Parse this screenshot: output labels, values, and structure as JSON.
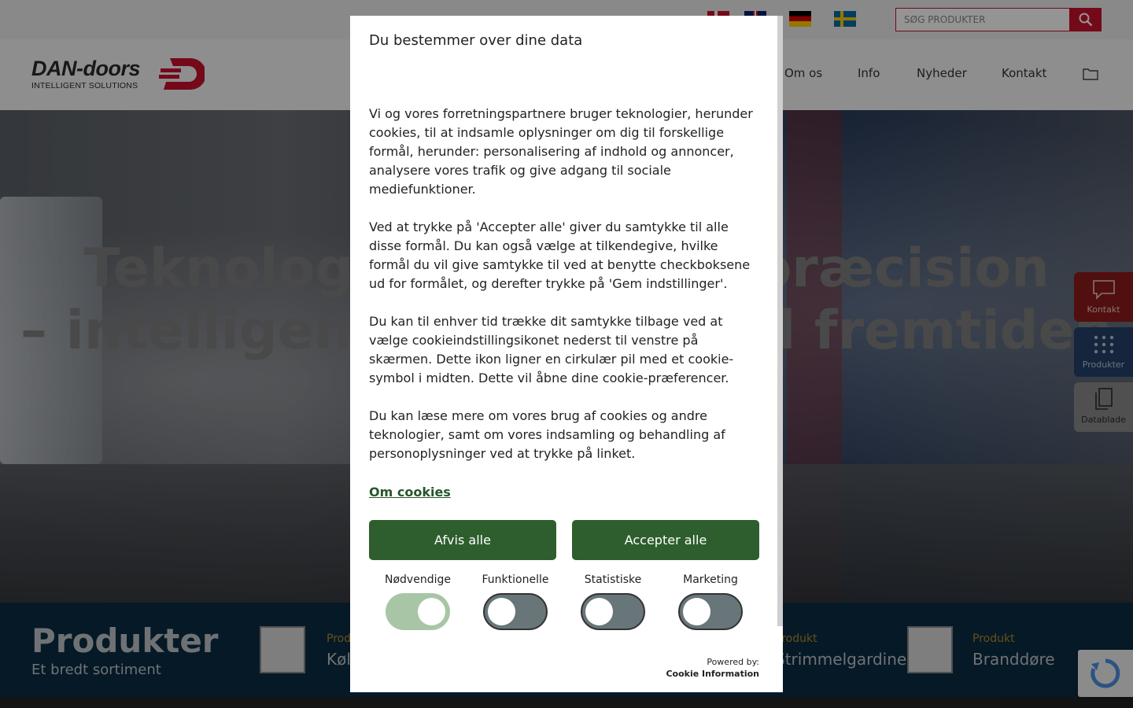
{
  "header": {
    "search_placeholder": "SØG PRODUKTER",
    "logo_text": "DAN-doors",
    "logo_tagline": "INTELLIGENT SOLUTIONS",
    "nav": [
      "Om os",
      "Info",
      "Nyheder",
      "Kontakt"
    ],
    "languages": [
      "dk-flag",
      "gb-flag",
      "de-flag",
      "se-flag"
    ]
  },
  "hero": {
    "title_line1": "Teknologi, kvalitet og præcision",
    "title_line2": "– intelligente løsninger til fremtiden"
  },
  "products_bar": {
    "title": "Produkter",
    "subtitle": "Et bredt sortiment",
    "items": [
      {
        "kicker": "Produkt",
        "name": "Kølerumsdøre"
      },
      {
        "kicker": "Produkt",
        "name": "Strimmelgardiner"
      },
      {
        "kicker": "Produkt",
        "name": "Branddøre"
      }
    ]
  },
  "side_buttons": [
    "Kontakt",
    "Produkter",
    "Datablade"
  ],
  "modal": {
    "title": "Du bestemmer over dine data",
    "paragraphs": [
      "Vi og vores forretningspartnere bruger teknologier, herunder cookies, til at indsamle oplysninger om dig til forskellige formål, herunder: personalisering af indhold og annoncer, analysere vores trafik og give adgang til sociale mediefunktioner.",
      "Ved at trykke på 'Accepter alle' giver du samtykke til alle disse formål. Du kan også vælge at tilkendegive, hvilke formål du vil give samtykke til ved at benytte checkboksene ud for formålet, og derefter trykke på 'Gem indstillinger'.",
      "Du kan til enhver tid trække dit samtykke tilbage ved at vælge cookieindstillingsikonet nederst til venstre på skærmen. Dette ikon ligner en cirkulær pil med et cookie-symbol i midten. Dette vil åbne dine cookie-præferencer.",
      "Du kan læse mere om vores brug af cookies og andre teknologier, samt om vores indsamling og behandling af personoplysninger ved at trykke på linket."
    ],
    "link": "Om cookies",
    "reject_label": "Afvis alle",
    "accept_label": "Accepter alle",
    "consents": [
      {
        "label": "Nødvendige",
        "checked": true
      },
      {
        "label": "Funktionelle",
        "checked": false
      },
      {
        "label": "Statistiske",
        "checked": false
      },
      {
        "label": "Marketing",
        "checked": false
      }
    ],
    "powered_by": "Powered by:",
    "powered_brand": "Cookie Information"
  },
  "colors": {
    "brand_red": "#c8102e",
    "button_green": "#2e5e2e",
    "toggle_on": "#a8c6a6",
    "toggle_off": "#68767a"
  }
}
